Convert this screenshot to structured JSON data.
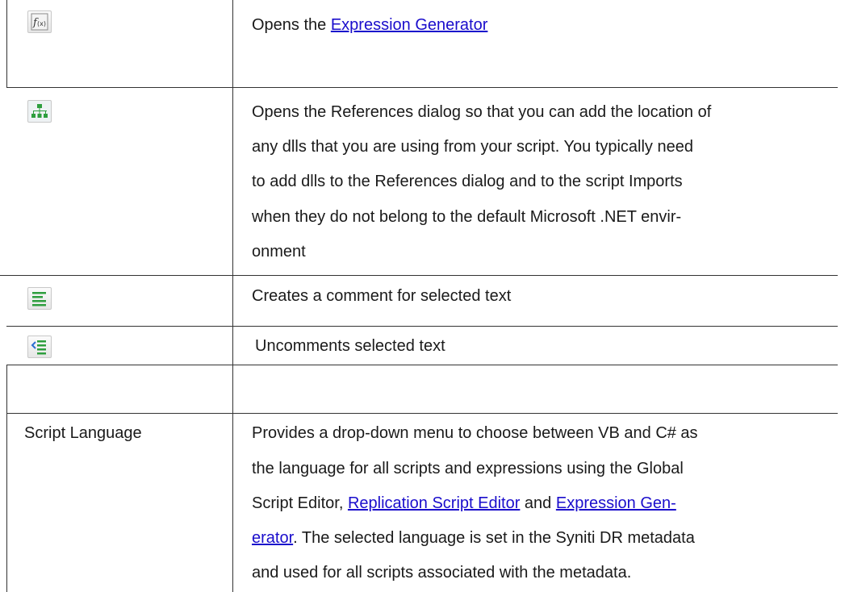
{
  "rows": [
    {
      "icon": "function-fx-icon",
      "text_prefix": "Opens the ",
      "link": "Expression Generator"
    },
    {
      "icon": "hierarchy-references-icon",
      "lines": [
        "Opens the References dialog so that you can add the location of",
        "any dlls that you are using from your script. You typically need",
        "to add dlls to the References dialog and to the script Imports",
        "when they do not belong to the default Microsoft .NET envir-",
        "onment"
      ]
    },
    {
      "icon": "comment-lines-icon",
      "text": "Creates a comment for selected text"
    },
    {
      "icon": "uncomment-icon",
      "text": "Uncomments selected text"
    },
    {
      "label": "Script Language",
      "line1": "Provides a drop-down menu to choose between VB and C# as",
      "line2": "the language for all scripts and expressions using the Global",
      "line3_prefix": "Script Editor, ",
      "line3_link1": "Replication Script Editor",
      "line3_mid": " and ",
      "line3_link2": "Expression Gen-",
      "line4_link": "erator",
      "line4_rest": ". The selected language is set in the Syniti DR metadata",
      "line5": "and used for all scripts associated with the metadata."
    }
  ],
  "colors": {
    "link": "#1a0dcc",
    "icon_green": "#2e9e3e",
    "rule": "#333333"
  }
}
